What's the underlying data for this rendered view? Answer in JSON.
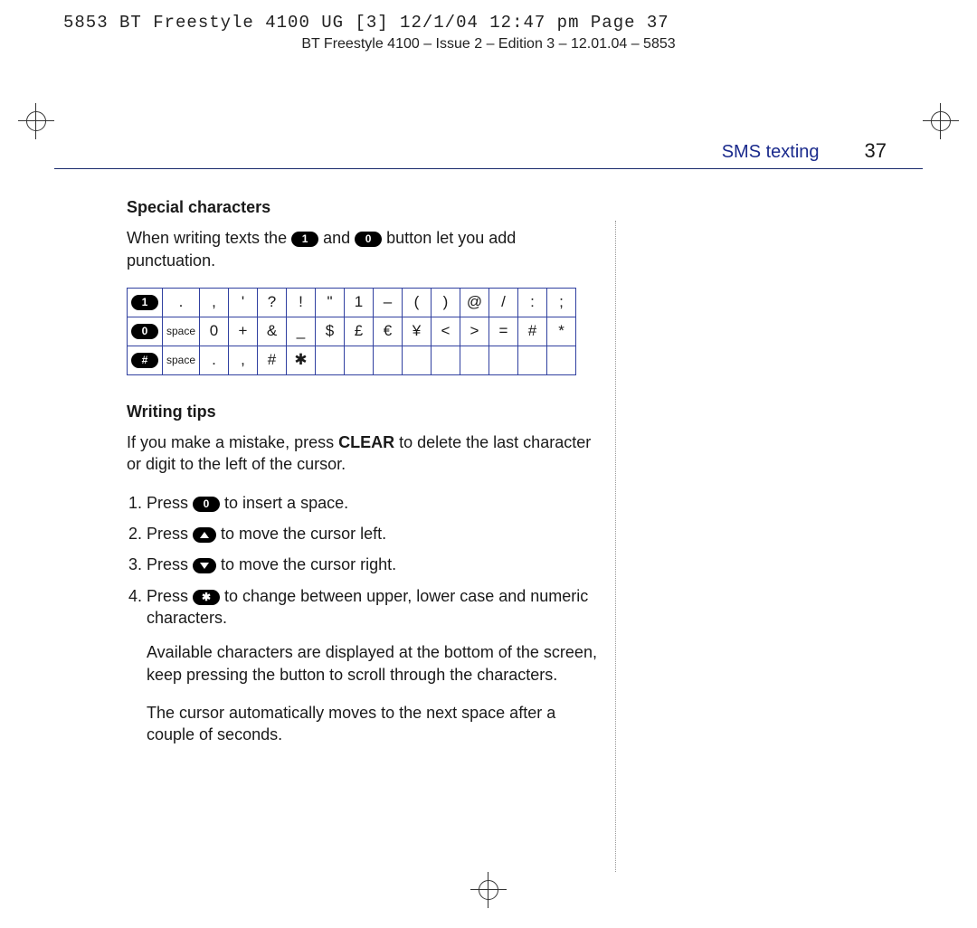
{
  "print_header": "5853 BT Freestyle 4100 UG [3]  12/1/04  12:47 pm  Page 37",
  "footer_line": "BT Freestyle 4100 – Issue 2 – Edition 3 – 12.01.04 – 5853",
  "section": "SMS texting",
  "page_number": "37",
  "h_special": "Special characters",
  "intro_a": "When writing texts the ",
  "btn1": "1",
  "intro_b": " and ",
  "btn0": "0",
  "intro_c": " button let you add punctuation.",
  "table": {
    "r1_key": "1",
    "r1": [
      ".",
      ",",
      "'",
      "?",
      "!",
      "\"",
      "1",
      "–",
      "(",
      ")",
      "@",
      "/",
      ":",
      ";"
    ],
    "r2_key": "0",
    "r2": [
      "space",
      "0",
      "+",
      "&",
      "_",
      "$",
      "£",
      "€",
      "¥",
      "<",
      ">",
      "=",
      "#",
      "*"
    ],
    "r3_key": "#",
    "r3": [
      "space",
      ".",
      ",",
      "#",
      "✱",
      "",
      "",
      "",
      "",
      "",
      "",
      "",
      "",
      ""
    ]
  },
  "h_tips": "Writing tips",
  "tips_intro_a": "If you make a mistake, press ",
  "tips_clear": "CLEAR",
  "tips_intro_b": " to delete the last character or digit to the left of the cursor.",
  "li1_a": "Press ",
  "li1_btn": "0",
  "li1_b": " to insert a space.",
  "li2_a": "Press ",
  "li2_b": " to move the cursor left.",
  "li3_a": "Press ",
  "li3_b": " to move the cursor right.",
  "li4_a": "Press ",
  "li4_btn": "✱",
  "li4_b": " to change between upper, lower case and numeric characters.",
  "p_avail": "Available characters are displayed at the bottom of the screen, keep pressing the button to scroll through the characters.",
  "p_cursor": "The cursor automatically moves to the next space after a couple of seconds."
}
